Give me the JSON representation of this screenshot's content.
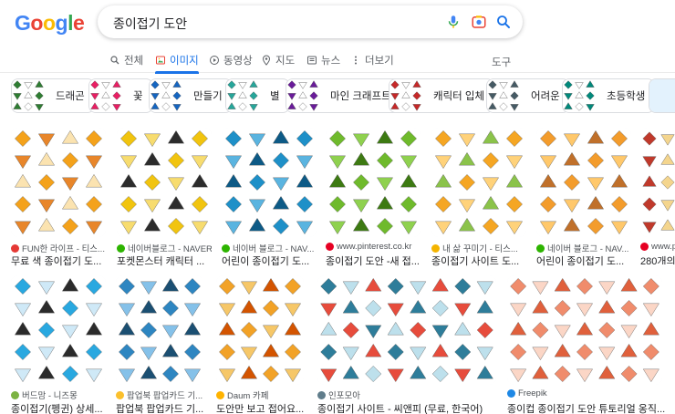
{
  "search": {
    "query": "종이접기 도안"
  },
  "logo": {
    "text": "Google",
    "colors": [
      "#4285f4",
      "#ea4335",
      "#fbbc05",
      "#4285f4",
      "#34a853",
      "#ea4335"
    ]
  },
  "tabs": [
    {
      "label": "전체",
      "icon": "search-icon",
      "active": false
    },
    {
      "label": "이미지",
      "icon": "image-icon",
      "active": true
    },
    {
      "label": "동영상",
      "icon": "play-icon",
      "active": false
    },
    {
      "label": "지도",
      "icon": "map-pin-icon",
      "active": false
    },
    {
      "label": "뉴스",
      "icon": "news-icon",
      "active": false
    },
    {
      "label": "더보기",
      "icon": "more-vert-icon",
      "active": false
    }
  ],
  "tools_label": "도구",
  "chips": [
    {
      "label": "드래곤",
      "thumb_color": "#2e7d32"
    },
    {
      "label": "꽃",
      "thumb_color": "#e91e63"
    },
    {
      "label": "만들기",
      "thumb_color": "#1565c0"
    },
    {
      "label": "별",
      "thumb_color": "#26a69a"
    },
    {
      "label": "마인 크래프트",
      "thumb_color": "#6a1b9a"
    },
    {
      "label": "캐릭터 입체",
      "thumb_color": "#c62828"
    },
    {
      "label": "어려운",
      "thumb_color": "#455a64"
    },
    {
      "label": "초등학생",
      "thumb_color": "#00897b"
    }
  ],
  "results_row1": [
    {
      "source": "FUN한 라이프 - 티스...",
      "title": "무료 색 종이접기 도...",
      "fav_color": "#e53935",
      "palette": [
        "#f4a21b",
        "#e8862a",
        "#fbe3b0"
      ]
    },
    {
      "source": "네이버블로그 - NAVER",
      "title": "포켓몬스터 캐릭터 ...",
      "fav_color": "#2db400",
      "palette": [
        "#f1c40f",
        "#f7dc6f",
        "#2c2c2c"
      ]
    },
    {
      "source": "네이버 블로그 - NAV...",
      "title": "어린이 종이접기 도...",
      "fav_color": "#2db400",
      "palette": [
        "#1e90c8",
        "#5ab4e0",
        "#0d5a86"
      ]
    },
    {
      "source": "www.pinterest.co.kr",
      "title": "종이접기 도안 -새 접...",
      "fav_color": "#e60023",
      "palette": [
        "#6fba2c",
        "#8fd14f",
        "#3d7a12"
      ]
    },
    {
      "source": "내 삶 꾸미기 - 티스...",
      "title": "종이접기 사이트 도...",
      "fav_color": "#f4b400",
      "palette": [
        "#f5a623",
        "#ffd27a",
        "#8bc34a"
      ]
    },
    {
      "source": "네이버 블로그 - NAV...",
      "title": "어린이 종이접기 도...",
      "fav_color": "#2db400",
      "palette": [
        "#f39c2c",
        "#ffc86b",
        "#c0702a"
      ]
    },
    {
      "source": "www.pi",
      "title": "280개의",
      "fav_color": "#e60023",
      "palette": [
        "#c0392b",
        "#f4d58d",
        "#e67e22"
      ]
    }
  ],
  "results_row2": [
    {
      "source": "버드맘 - 니즈몽",
      "title": "종이접기(펭귄) 상세...",
      "fav_color": "#7cb342",
      "palette": [
        "#29a8e0",
        "#cfe9f7",
        "#2b2b2b"
      ]
    },
    {
      "source": "팝업북 팝업카드 기...",
      "title": "팝업북 팝업카드 기...",
      "fav_color": "#fbc02d",
      "palette": [
        "#2e86c1",
        "#85c1e9",
        "#1b4f72"
      ]
    },
    {
      "source": "Daum 카페",
      "title": "도안만 보고 접어요...",
      "fav_color": "#ffb300",
      "palette": [
        "#f2a227",
        "#f6c768",
        "#d35400"
      ]
    },
    {
      "source": "인포모아",
      "title": "종이접기 사이트 - 씨앤피 (무료, 한국어)",
      "fav_color": "#607d8b",
      "palette": [
        "#2e7d9a",
        "#bde0ec",
        "#e74c3c"
      ]
    },
    {
      "source": "Freepik",
      "title": "종이컵 종이접기 도안 튜토리얼 옹직...",
      "fav_color": "#1e88e5",
      "palette": [
        "#f08c6c",
        "#fbd6c6",
        "#e0603c"
      ]
    }
  ]
}
